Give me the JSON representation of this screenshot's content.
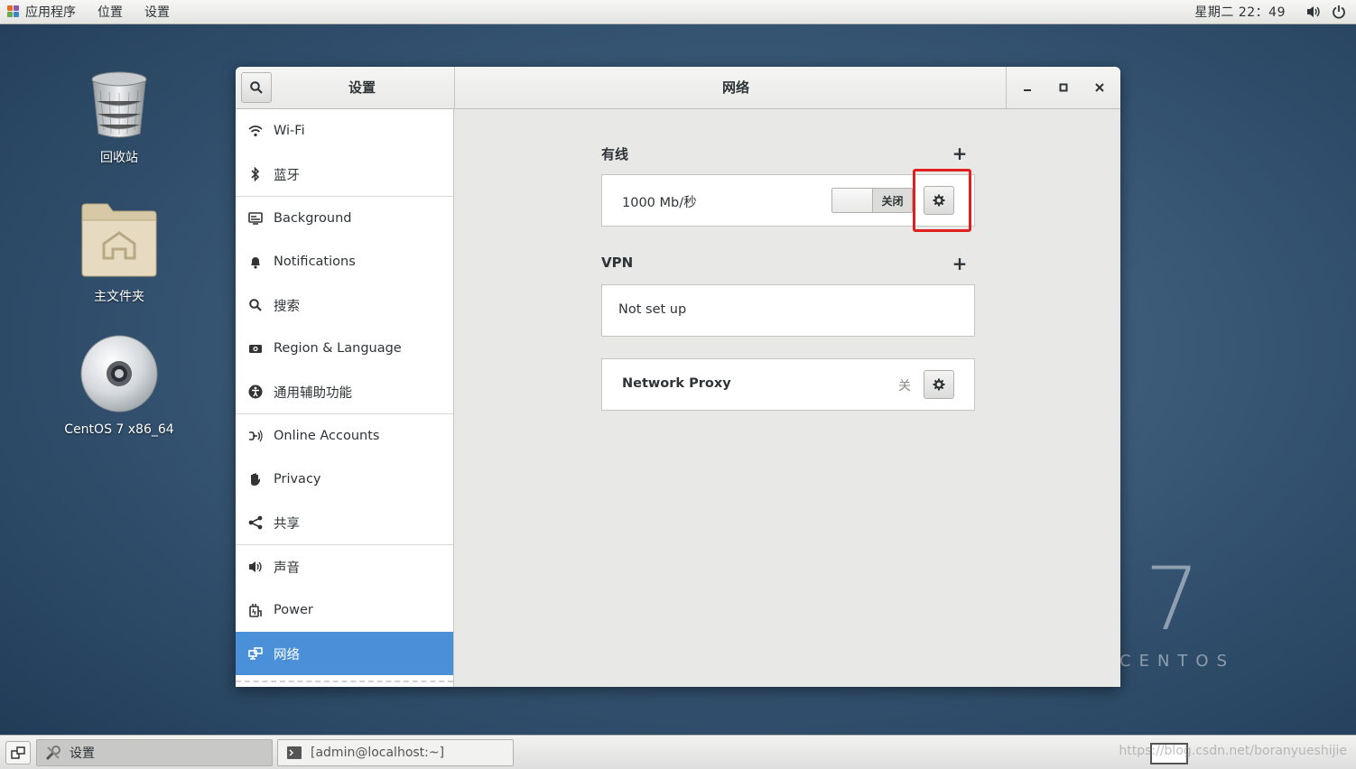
{
  "top_panel": {
    "applications": "应用程序",
    "places": "位置",
    "settings": "设置",
    "clock": "星期二 22：49"
  },
  "desktop": {
    "trash_label": "回收站",
    "home_label": "主文件夹",
    "disc_label": "CentOS 7 x86_64",
    "brand_number": "7",
    "brand_word": "CENTOS"
  },
  "window": {
    "sidebar_title": "设置",
    "main_title": "网络",
    "sidebar": {
      "items": [
        {
          "label": "Wi-Fi",
          "icon": "wifi-icon"
        },
        {
          "label": "蓝牙",
          "icon": "bluetooth-icon"
        },
        {
          "label": "Background",
          "icon": "background-icon"
        },
        {
          "label": "Notifications",
          "icon": "bell-icon"
        },
        {
          "label": "搜索",
          "icon": "search-icon"
        },
        {
          "label": "Region & Language",
          "icon": "camera-icon"
        },
        {
          "label": "通用辅助功能",
          "icon": "accessibility-icon"
        },
        {
          "label": "Online Accounts",
          "icon": "online-accounts-icon"
        },
        {
          "label": "Privacy",
          "icon": "hand-icon"
        },
        {
          "label": "共享",
          "icon": "share-icon"
        },
        {
          "label": "声音",
          "icon": "speaker-icon"
        },
        {
          "label": "Power",
          "icon": "power-plug-icon"
        },
        {
          "label": "网络",
          "icon": "network-icon",
          "selected": true
        }
      ]
    },
    "network": {
      "wired": {
        "section_label": "有线",
        "connection_speed": "1000 Mb/秒",
        "switch_label": "关闭"
      },
      "vpn": {
        "section_label": "VPN",
        "status": "Not set up"
      },
      "proxy": {
        "label": "Network Proxy",
        "status": "关"
      }
    }
  },
  "taskbar": {
    "tasks": [
      {
        "label": "设置",
        "icon": "settings-tools-icon",
        "active": true
      },
      {
        "label": "[admin@localhost:~]",
        "icon": "terminal-icon",
        "active": false
      }
    ],
    "watermark": "https://blog.csdn.net/boranyueshijie"
  },
  "colors": {
    "selection": "#4a90d9",
    "highlight_box": "#e0201c",
    "desktop": "#3a5a78"
  }
}
